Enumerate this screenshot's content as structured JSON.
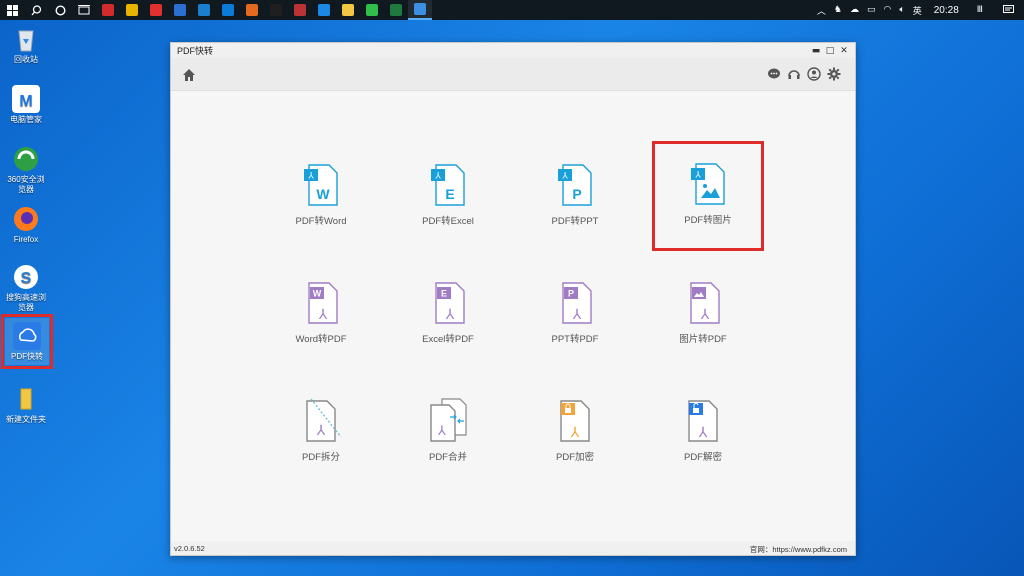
{
  "taskbar": {
    "language": "英",
    "time": "20:28",
    "app_colors": [
      "#d22b2b",
      "#e8b400",
      "#e03030",
      "#2b6fd2",
      "#1a7fcf",
      "#0c7ad8",
      "#e46a1f",
      "#1f1f1f",
      "#b33",
      "#1e88e5",
      "#f2c744",
      "#2fbf4a",
      "#1e7a3e",
      "#3b8fe5"
    ]
  },
  "desktop": {
    "icons": [
      {
        "label": "回收站",
        "color": "#cfd9e6"
      },
      {
        "label": "电脑管家",
        "color": "#1f7ae0"
      },
      {
        "label": "360安全浏览器",
        "color": "#2ea043"
      },
      {
        "label": "Firefox",
        "color": "#ff7a1a"
      },
      {
        "label": "搜狗高速浏览器",
        "color": "#2b7fd4"
      },
      {
        "label": "PDF快转",
        "color": "#2b7be6"
      },
      {
        "label": "新建文件夹",
        "color": "#f2c744"
      }
    ]
  },
  "window": {
    "title": "PDF快转",
    "controls": {
      "minimize": "▬",
      "maximize": "□",
      "close": "✕"
    }
  },
  "tools": {
    "row1": [
      {
        "label": "PDF转Word",
        "letter": "W"
      },
      {
        "label": "PDF转Excel",
        "letter": "E"
      },
      {
        "label": "PDF转PPT",
        "letter": "P"
      },
      {
        "label": "PDF转图片",
        "letter": ""
      }
    ],
    "row2": [
      {
        "label": "Word转PDF",
        "letter": "W"
      },
      {
        "label": "Excel转PDF",
        "letter": "E"
      },
      {
        "label": "PPT转PDF",
        "letter": "P"
      },
      {
        "label": "图片转PDF",
        "letter": ""
      }
    ],
    "row3": [
      {
        "label": "PDF拆分"
      },
      {
        "label": "PDF合并"
      },
      {
        "label": "PDF加密"
      },
      {
        "label": "PDF解密"
      }
    ]
  },
  "colors": {
    "blue": "#1aa0d8",
    "purple": "#a07cc5",
    "orange": "#f2a33a",
    "highlight": "#e02b2b"
  },
  "status": {
    "version": "v2.0.6.52",
    "website": "官网：https://www.pdfkz.com"
  }
}
